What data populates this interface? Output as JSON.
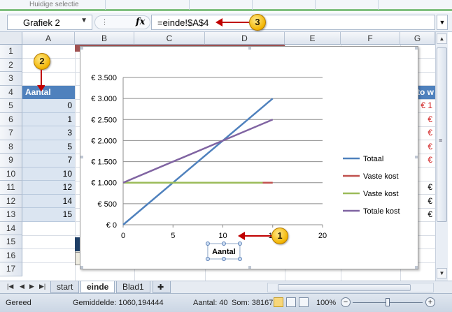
{
  "ribbon": {
    "selection_label": "Huidige selectie"
  },
  "formula_bar": {
    "name_box": "Grafiek 2",
    "fx": "fx",
    "formula": "=einde!$A$4"
  },
  "callouts": [
    "1",
    "2",
    "3"
  ],
  "columns": [
    "A",
    "B",
    "C",
    "D",
    "E",
    "F",
    "G"
  ],
  "rows": [
    "1",
    "2",
    "3",
    "4",
    "5",
    "6",
    "7",
    "8",
    "9",
    "10",
    "11",
    "12",
    "13",
    "14",
    "15",
    "16",
    "17"
  ],
  "cells": {
    "a4": "Aantal",
    "a_values": [
      "0",
      "1",
      "3",
      "5",
      "7",
      "10",
      "12",
      "14",
      "15"
    ],
    "g4": "tto w",
    "g5": "€ 1",
    "g6": "€",
    "g7": "€",
    "g8": "€",
    "g9": "€",
    "g11": "€",
    "g12": "€",
    "g13": "€"
  },
  "chart_data": {
    "type": "line",
    "x": [
      0,
      15
    ],
    "xlim": [
      0,
      20
    ],
    "ylim": [
      0,
      3500
    ],
    "x_ticks": [
      "0",
      "5",
      "10",
      "15",
      "20"
    ],
    "y_ticks": [
      "€ 0",
      "€ 500",
      "€ 1.000",
      "€ 1.500",
      "€ 2.000",
      "€ 2.500",
      "€ 3.000",
      "€ 3.500"
    ],
    "xlabel": "Aantal",
    "grid": "horizontal",
    "legend_position": "right",
    "series": [
      {
        "name": "Totaal",
        "color": "#4f81bd",
        "x": [
          0,
          15
        ],
        "values": [
          0,
          3000
        ]
      },
      {
        "name": "Vaste kost",
        "color": "#c0504d",
        "x": [
          0,
          15
        ],
        "values": [
          1000,
          1000
        ]
      },
      {
        "name": "Vaste kost",
        "color": "#9bbb59",
        "x": [
          0,
          14
        ],
        "values": [
          1000,
          1000
        ]
      },
      {
        "name": "Totale kost",
        "color": "#8064a2",
        "x": [
          0,
          15
        ],
        "values": [
          1000,
          2500
        ]
      }
    ]
  },
  "sheet_tabs": [
    "start",
    "einde",
    "Blad1"
  ],
  "active_tab": "einde",
  "status": {
    "ready": "Gereed",
    "average": "Gemiddelde: 1060,194444",
    "count": "Aantal: 40",
    "sum": "Som: 38167",
    "zoom": "100%"
  }
}
